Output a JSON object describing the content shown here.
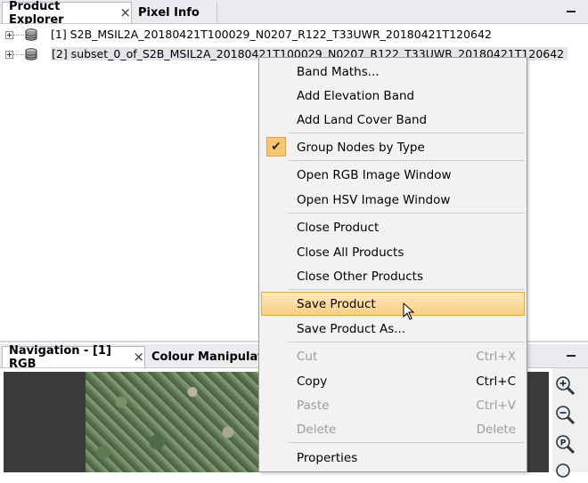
{
  "top_tabs": [
    {
      "label": "Product Explorer",
      "active": true,
      "close_icon": "×"
    },
    {
      "label": "Pixel Info",
      "active": false
    }
  ],
  "tree": {
    "items": [
      {
        "label": "[1] S2B_MSIL2A_20180421T100029_N0207_R122_T33UWR_20180421T120642",
        "selected": false,
        "icon": "database-icon"
      },
      {
        "label": "[2] subset_0_of_S2B_MSIL2A_20180421T100029_N0207_R122_T33UWR_20180421T120642",
        "selected": true,
        "icon": "database-icon"
      }
    ]
  },
  "bottom_tabs": [
    {
      "label": "Navigation - [1] RGB",
      "active": true,
      "close_icon": "×"
    },
    {
      "label": "Colour Manipulati",
      "active": false
    }
  ],
  "context_menu": {
    "items": [
      {
        "label": "Band Maths...",
        "shortcut": "",
        "disabled": false
      },
      {
        "label": "Add Elevation Band",
        "shortcut": "",
        "disabled": false
      },
      {
        "label": "Add Land Cover Band",
        "shortcut": "",
        "disabled": false
      },
      {
        "label": "Group Nodes by Type",
        "shortcut": "",
        "disabled": false,
        "checked": true,
        "check_glyph": "✔"
      },
      {
        "label": "Open RGB Image Window",
        "shortcut": "",
        "disabled": false
      },
      {
        "label": "Open HSV Image Window",
        "shortcut": "",
        "disabled": false
      },
      {
        "label": "Close Product",
        "shortcut": "",
        "disabled": false
      },
      {
        "label": "Close All Products",
        "shortcut": "",
        "disabled": false
      },
      {
        "label": "Close Other Products",
        "shortcut": "",
        "disabled": false
      },
      {
        "label": "Save Product",
        "shortcut": "",
        "disabled": false,
        "hovered": true
      },
      {
        "label": "Save Product As...",
        "shortcut": "",
        "disabled": false
      },
      {
        "label": "Cut",
        "shortcut": "Ctrl+X",
        "disabled": true
      },
      {
        "label": "Copy",
        "shortcut": "Ctrl+C",
        "disabled": false
      },
      {
        "label": "Paste",
        "shortcut": "Ctrl+V",
        "disabled": true
      },
      {
        "label": "Delete",
        "shortcut": "Delete",
        "disabled": true
      },
      {
        "label": "Properties",
        "shortcut": "",
        "disabled": false
      }
    ]
  },
  "toolbar_icons": [
    "zoom-in-icon",
    "zoom-out-icon",
    "zoom-pixel-icon"
  ],
  "colors": {
    "tab_bar_bg": "#e9e9ee",
    "menu_bg": "#f2f2f2",
    "hover_highlight": "#f8cf80",
    "check_highlight": "#f9c56e",
    "disabled_text": "#9b9b9b"
  }
}
